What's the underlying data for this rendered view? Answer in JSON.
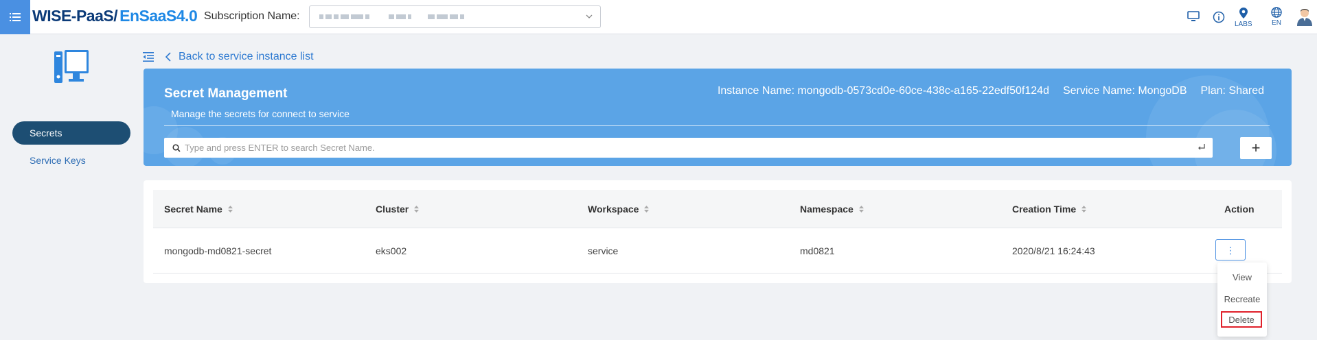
{
  "header": {
    "logo_part1": "WISE-PaaS/",
    "logo_part2": "EnSaaS4.0",
    "subscription_label": "Subscription Name:",
    "labs_label": "LABS",
    "lang_label": "EN"
  },
  "sidebar": {
    "items": [
      {
        "label": "Secrets",
        "active": true
      },
      {
        "label": "Service Keys",
        "active": false
      }
    ]
  },
  "nav": {
    "back_label": "Back to service instance list"
  },
  "banner": {
    "title": "Secret Management",
    "description": "Manage the secrets for connect to service",
    "instance_name": "Instance Name: mongodb-0573cd0e-60ce-438c-a165-22edf50f124d",
    "service_name": "Service Name: MongoDB",
    "plan": "Plan: Shared",
    "search_placeholder": "Type and press ENTER to search Secret Name.",
    "add_label": "+"
  },
  "table": {
    "columns": [
      "Secret Name",
      "Cluster",
      "Workspace",
      "Namespace",
      "Creation Time",
      "Action"
    ],
    "rows": [
      {
        "secret_name": "mongodb-md0821-secret",
        "cluster": "eks002",
        "workspace": "service",
        "namespace": "md0821",
        "creation_time": "2020/8/21 16:24:43"
      }
    ]
  },
  "action_menu": {
    "button_label": "⋮",
    "items": [
      "View",
      "Recreate",
      "Delete"
    ]
  },
  "colors": {
    "accent": "#4a90e2",
    "banner": "#5ba4e6",
    "sidebar_active": "#1d4e73",
    "highlight": "#e0202a"
  }
}
